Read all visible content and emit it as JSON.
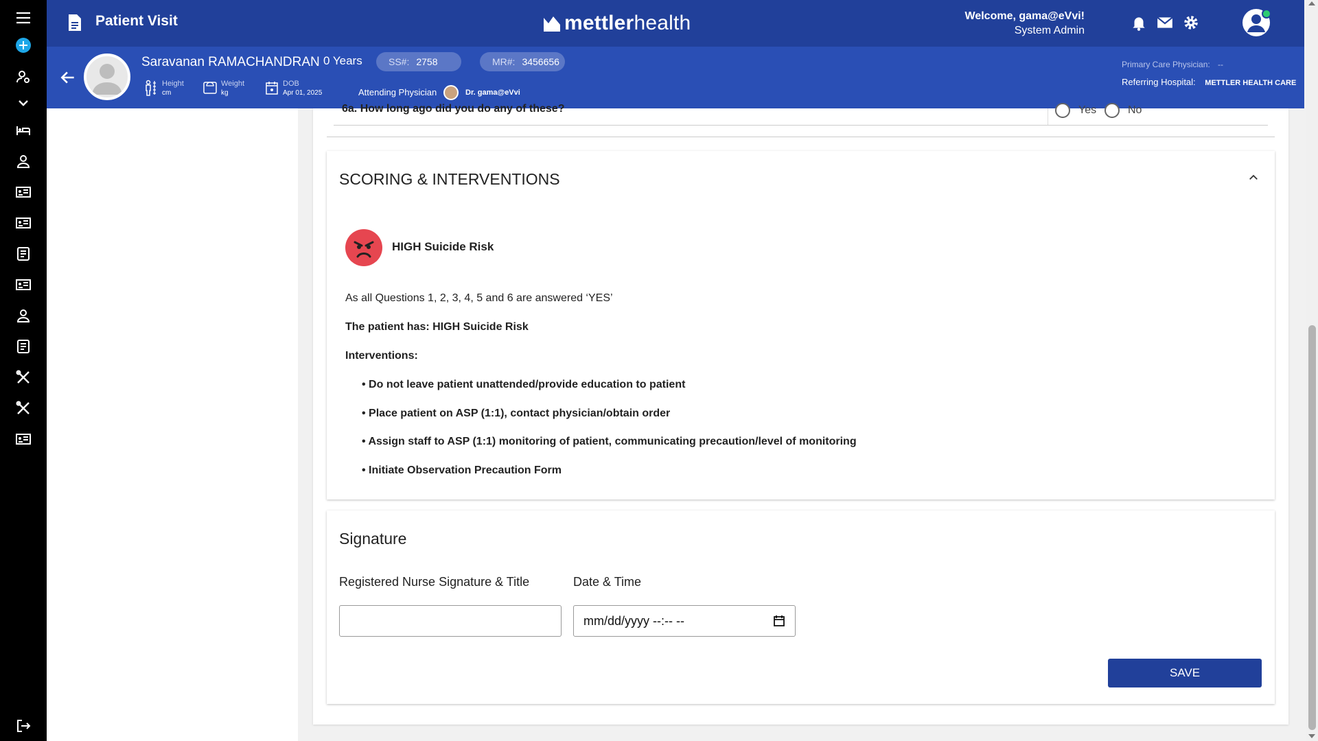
{
  "app": {
    "page_title": "Patient Visit",
    "logo": {
      "prefix": "mettler",
      "suffix": "health"
    },
    "welcome": "Welcome, gama@eVvi!",
    "role": "System Admin"
  },
  "patient": {
    "name": "Saravanan RAMACHANDRAN",
    "age": "0 Years",
    "ss_label": "SS#:",
    "ss_value": "2758",
    "mr_label": "MR#:",
    "mr_value": "3456656",
    "height_label": "Height",
    "height_unit": "cm",
    "weight_label": "Weight",
    "weight_unit": "kg",
    "dob_label": "DOB",
    "dob_value": "Apr 01, 2025",
    "attending_label": "Attending Physician",
    "attending_name": "Dr. gama@eVvi",
    "pcp_label": "Primary Care Physician:",
    "pcp_value": "--",
    "referring_label": "Referring Hospital:",
    "referring_value": "METTLER HEALTH CARE"
  },
  "question": {
    "text": "6a. How long ago did you do any of these?",
    "yes": "Yes",
    "no": "No"
  },
  "scoring": {
    "title": "SCORING & INTERVENTIONS",
    "risk_label": "HIGH Suicide Risk",
    "reason": "As all Questions 1, 2, 3, 4, 5 and 6 are answered ‘YES’",
    "summary": "The patient has: HIGH Suicide Risk",
    "interventions_label": "Interventions:",
    "interventions": [
      "• Do not leave patient unattended/provide education to patient",
      "• Place patient on ASP (1:1), contact physician/obtain order",
      "• Assign staff to ASP (1:1) monitoring of patient, communicating precaution/level of monitoring",
      "• Initiate Observation Precaution Form"
    ]
  },
  "signature": {
    "title": "Signature",
    "nurse_label": "Registered Nurse Signature & Title",
    "nurse_value": "",
    "datetime_label": "Date & Time",
    "datetime_placeholder": "mm/dd/yyyy --:-- --",
    "save_label": "SAVE"
  },
  "colors": {
    "header": "#21409a",
    "patient_bar": "#2a4fb5",
    "risk_red": "#e64650",
    "sidebar": "#000000"
  }
}
